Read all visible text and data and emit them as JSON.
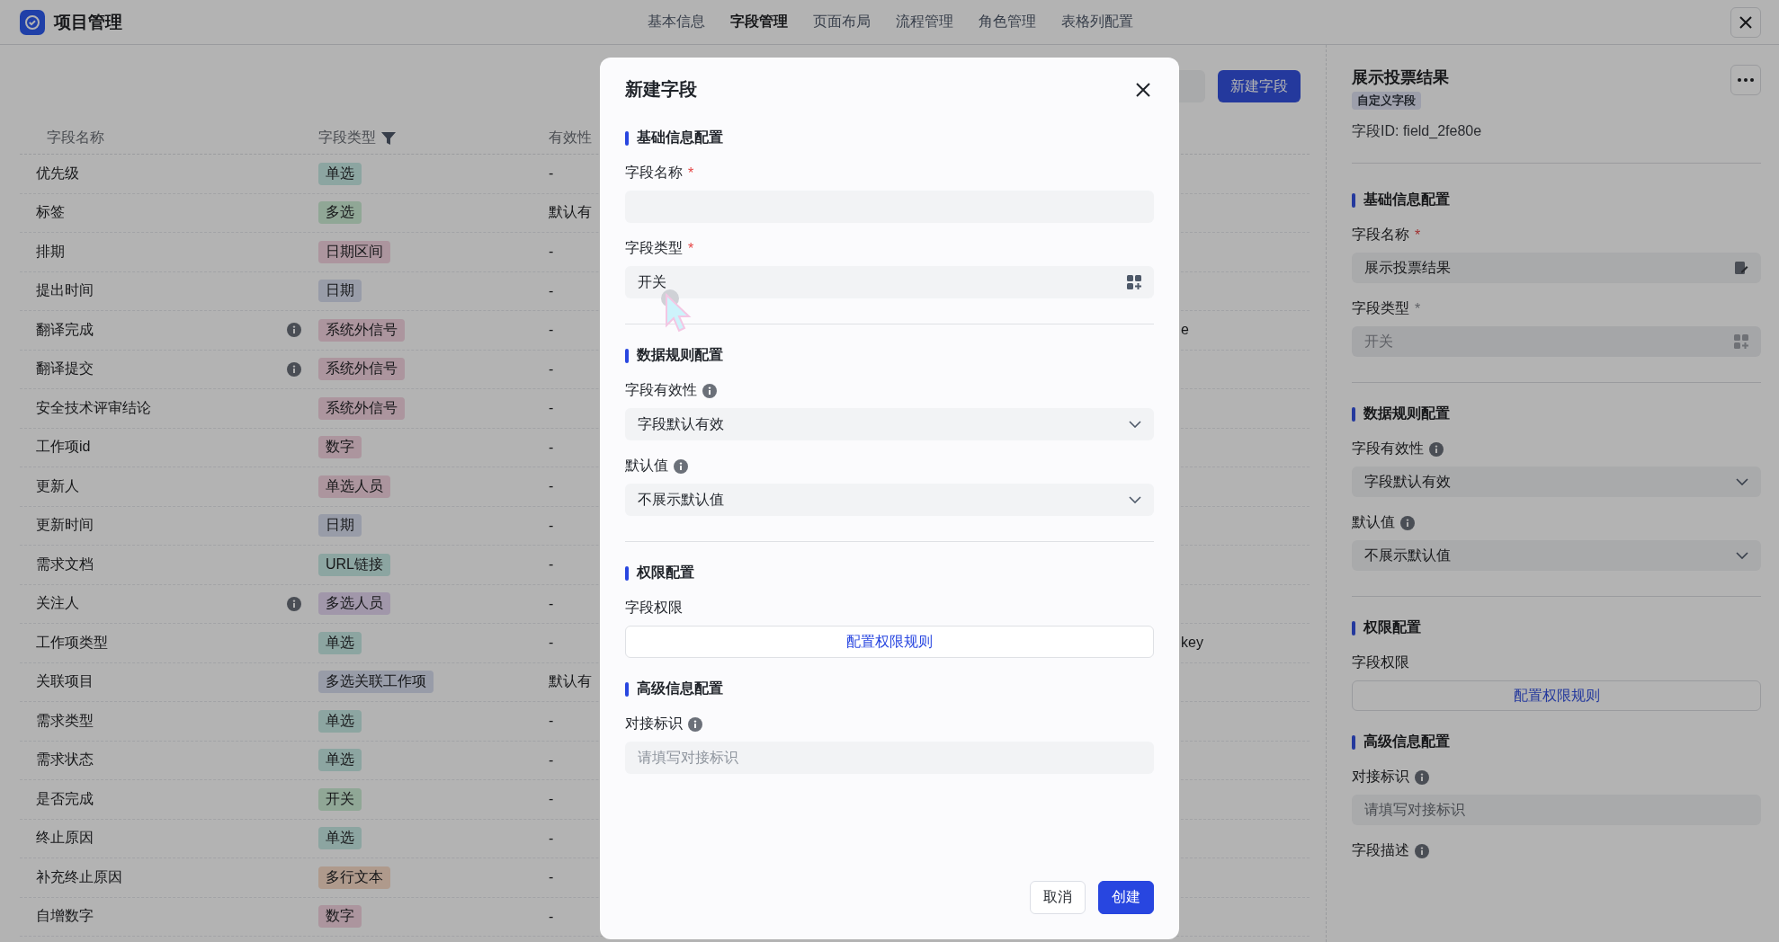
{
  "app": {
    "title": "项目管理"
  },
  "nav_tabs": [
    {
      "label": "基本信息",
      "selected": false
    },
    {
      "label": "字段管理",
      "selected": true
    },
    {
      "label": "页面布局",
      "selected": false
    },
    {
      "label": "流程管理",
      "selected": false
    },
    {
      "label": "角色管理",
      "selected": false
    },
    {
      "label": "表格列配置",
      "selected": false
    }
  ],
  "toolbar": {
    "new_button": "新建字段"
  },
  "table": {
    "columns": [
      "字段名称",
      "字段类型",
      "有效性"
    ],
    "rows": [
      {
        "name": "优先级",
        "info": false,
        "type": "单选",
        "color": "#8ca5a1",
        "validity": "-"
      },
      {
        "name": "标签",
        "info": false,
        "type": "多选",
        "color": "#90a796",
        "validity": "默认有"
      },
      {
        "name": "排期",
        "info": false,
        "type": "日期区间",
        "color": "#ac959e",
        "validity": "-"
      },
      {
        "name": "提出时间",
        "info": false,
        "type": "日期",
        "color": "#989ca8",
        "validity": "-"
      },
      {
        "name": "翻译完成",
        "info": true,
        "type": "系统外信号",
        "color": "#ac959e",
        "validity": "-",
        "column_4": "e"
      },
      {
        "name": "翻译提交",
        "info": true,
        "type": "系统外信号",
        "color": "#ac959e",
        "validity": "-"
      },
      {
        "name": "安全技术评审结论",
        "info": false,
        "type": "系统外信号",
        "color": "#ac959e",
        "validity": "-"
      },
      {
        "name": "工作项id",
        "info": false,
        "type": "数字",
        "color": "#ac959e",
        "validity": "-"
      },
      {
        "name": "更新人",
        "info": false,
        "type": "单选人员",
        "color": "#ac959e",
        "validity": "-"
      },
      {
        "name": "更新时间",
        "info": false,
        "type": "日期",
        "color": "#989ca8",
        "validity": "-"
      },
      {
        "name": "需求文档",
        "info": false,
        "type": "URL链接",
        "color": "#8ca5a1",
        "validity": "-"
      },
      {
        "name": "关注人",
        "info": true,
        "type": "多选人员",
        "color": "#a197aa",
        "validity": "-"
      },
      {
        "name": "工作项类型",
        "info": false,
        "type": "单选",
        "color": "#8ca5a1",
        "validity": "-",
        "column_4": "key"
      },
      {
        "name": "关联项目",
        "info": false,
        "type": "多选关联工作项",
        "color": "#989ca8",
        "validity": "默认有"
      },
      {
        "name": "需求类型",
        "info": false,
        "type": "单选",
        "color": "#8ca5a1",
        "validity": "-"
      },
      {
        "name": "需求状态",
        "info": false,
        "type": "单选",
        "color": "#8ca5a1",
        "validity": "-"
      },
      {
        "name": "是否完成",
        "info": false,
        "type": "开关",
        "color": "#90a796",
        "validity": "-"
      },
      {
        "name": "终止原因",
        "info": false,
        "type": "单选",
        "color": "#8ca5a1",
        "validity": "-"
      },
      {
        "name": "补充终止原因",
        "info": false,
        "type": "多行文本",
        "color": "#af9a8c",
        "validity": "-"
      },
      {
        "name": "自增数字",
        "info": false,
        "type": "数字",
        "color": "#ac959e",
        "validity": "-"
      }
    ]
  },
  "detail_panel": {
    "title": "展示投票结果",
    "tag": "自定义字段",
    "field_id_label": "字段ID:",
    "field_id": "field_2fe80e",
    "sections": [
      {
        "title": "基础信息配置",
        "divider_after": true,
        "fields": [
          {
            "label": "字段名称",
            "required_mark": "*",
            "info": false,
            "kind": "input_edit",
            "value": "展示投票结果"
          },
          {
            "label": "字段类型",
            "required_mark": "*",
            "info": false,
            "kind": "picker",
            "value": "开关",
            "disabled": true
          }
        ]
      },
      {
        "title": "数据规则配置",
        "divider_after": true,
        "fields": [
          {
            "label": "字段有效性",
            "info": true,
            "kind": "select",
            "value": "字段默认有效"
          },
          {
            "label": "默认值",
            "info": true,
            "kind": "select",
            "value": "不展示默认值"
          }
        ]
      },
      {
        "title": "权限配置",
        "divider_after": false,
        "fields": [
          {
            "label": "字段权限",
            "info": false,
            "kind": "button",
            "value": "配置权限规则"
          }
        ]
      },
      {
        "title": "高级信息配置",
        "divider_after": false,
        "fields": [
          {
            "label": "对接标识",
            "info": true,
            "kind": "input",
            "placeholder": "请填写对接标识"
          },
          {
            "label": "字段描述",
            "info": true,
            "kind": "label"
          }
        ]
      }
    ]
  },
  "dialog": {
    "title": "新建字段",
    "sections": [
      {
        "title": "基础信息配置",
        "divider_after": true,
        "fields": [
          {
            "label": "字段名称",
            "required_mark": "*",
            "info": false,
            "kind": "input"
          },
          {
            "label": "字段类型",
            "required_mark": "*",
            "info": false,
            "kind": "picker",
            "value": "开关",
            "disabled": false
          }
        ]
      },
      {
        "title": "数据规则配置",
        "divider_after": true,
        "fields": [
          {
            "label": "字段有效性",
            "info": true,
            "kind": "select",
            "value": "字段默认有效"
          },
          {
            "label": "默认值",
            "info": true,
            "kind": "select",
            "value": "不展示默认值"
          }
        ]
      },
      {
        "title": "权限配置",
        "divider_after": false,
        "fields": [
          {
            "label": "字段权限",
            "info": false,
            "kind": "button",
            "value": "配置权限规则"
          }
        ]
      },
      {
        "title": "高级信息配置",
        "divider_after": false,
        "fields": [
          {
            "label": "对接标识",
            "info": true,
            "kind": "input",
            "placeholder": "请填写对接标识"
          }
        ]
      }
    ],
    "cancel": "取消",
    "confirm": "创建"
  }
}
